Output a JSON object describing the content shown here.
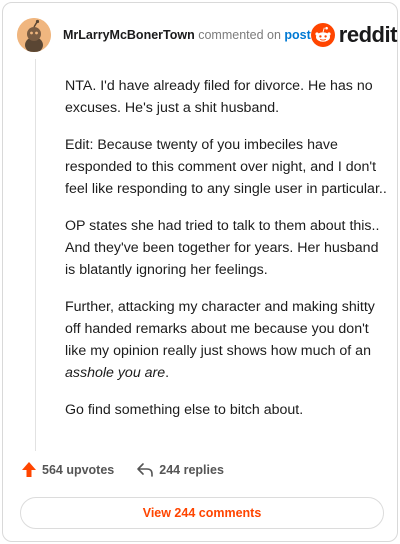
{
  "header": {
    "username": "MrLarryMcBonerTown",
    "action_text": "commented on",
    "post_link": "post",
    "brand": "reddit"
  },
  "comment": {
    "paragraphs": [
      {
        "text": "NTA. I'd have already filed for divorce. He has no excuses. He's just a shit husband."
      },
      {
        "text": "Edit: Because twenty of you imbeciles have responded to this comment over night, and I don't feel like responding to any single user in particular.."
      },
      {
        "text": "OP states she had tried to talk to them about this.. And they've been together for years. Her husband is blatantly ignoring her feelings."
      },
      {
        "text": "Further, attacking my character and making shitty off handed remarks about me because you don't like my opinion really just shows how much of an ",
        "italic": "asshole you are",
        "tail": "."
      },
      {
        "text": "Go find something else to bitch about."
      }
    ]
  },
  "footer": {
    "upvotes": "564 upvotes",
    "replies": "244 replies",
    "view_comments": "View 244 comments"
  },
  "colors": {
    "accent": "#ff4500",
    "link": "#0079d3"
  },
  "icons": {
    "upvote": "upvote-arrow-icon",
    "reply": "reply-arrow-icon",
    "brand": "reddit-snoo-icon"
  }
}
